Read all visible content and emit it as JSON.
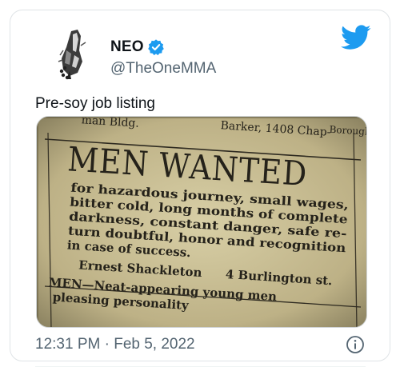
{
  "tweet": {
    "display_name": "NEO",
    "handle": "@TheOneMMA",
    "text": "Pre-soy job listing",
    "timestamp": "12:31 PM · Feb 5, 2022",
    "verified": true
  },
  "icons": {
    "verified": "verified-badge-icon",
    "brand": "twitter-bird-icon",
    "info": "info-icon"
  },
  "colors": {
    "brand_blue": "#1d9bf0",
    "text_primary": "#0f1419",
    "text_secondary": "#536471"
  },
  "clipping": {
    "top_fragment_left": "man Bldg.",
    "top_fragment_right": "Barker, 1408 Chap-",
    "top_fragment_far_right": "Borough.",
    "headline": "MEN WANTED",
    "body_lines": [
      "for hazardous journey, small wages,",
      "bitter cold, long months of complete",
      "darkness, constant danger, safe re-",
      "turn doubtful, honor and recognition",
      "in case of success."
    ],
    "signature_name": "Ernest Shackleton",
    "signature_address": "4 Burlington st.",
    "bottom_line_1": "MEN—Neat-appearing young men",
    "bottom_line_2": "pleasing personality"
  }
}
